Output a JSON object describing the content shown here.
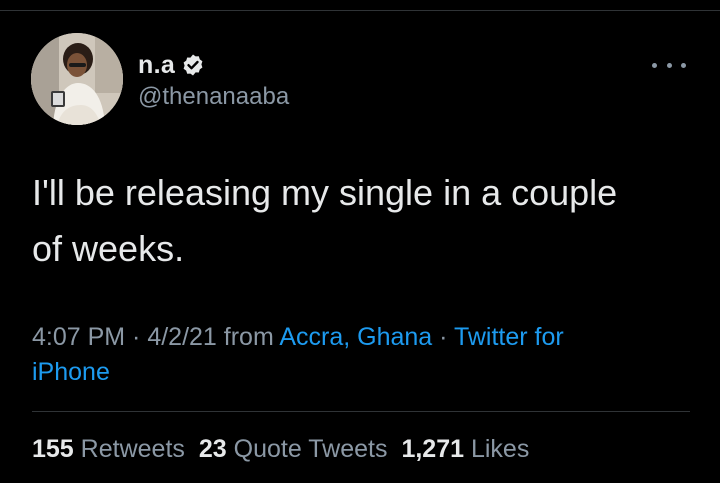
{
  "tweet": {
    "author": {
      "display_name": "n.a",
      "handle": "@thenanaaba",
      "verified": true,
      "avatar_icon": "profile-photo"
    },
    "more_icon": "more-horizontal-icon",
    "text_line1": "I'll be releasing my single in a couple",
    "text_line2": "of weeks.",
    "meta": {
      "time": "4:07 PM",
      "sep1": " · ",
      "date": "4/2/21",
      "from": " from ",
      "location": "Accra, Ghana",
      "sep2": " · ",
      "source_part1": "Twitter for",
      "source_part2": "iPhone"
    },
    "stats": {
      "retweets_count": "155",
      "retweets_label": "Retweets",
      "quotes_count": "23",
      "quotes_label": "Quote Tweets",
      "likes_count": "1,271",
      "likes_label": "Likes"
    }
  },
  "colors": {
    "background": "#000000",
    "text_primary": "#e7e9ea",
    "text_secondary": "#8b98a5",
    "link": "#1d9bf0",
    "divider": "#2f3336"
  }
}
